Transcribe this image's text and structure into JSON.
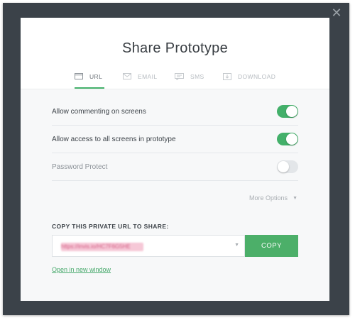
{
  "modal": {
    "title": "Share Prototype",
    "close_glyph": "✕"
  },
  "tabs": [
    {
      "label": "URL",
      "icon": "browser-window-icon",
      "active": true
    },
    {
      "label": "EMAIL",
      "icon": "envelope-icon",
      "active": false
    },
    {
      "label": "SMS",
      "icon": "chat-bubble-icon",
      "active": false
    },
    {
      "label": "DOWNLOAD",
      "icon": "download-icon",
      "active": false
    }
  ],
  "options": [
    {
      "label": "Allow commenting on screens",
      "enabled": true
    },
    {
      "label": "Allow access to all screens in prototype",
      "enabled": true
    },
    {
      "label": "Password Protect",
      "enabled": false
    }
  ],
  "more_options": {
    "label": "More Options",
    "caret": "▼"
  },
  "share": {
    "label": "COPY THIS PRIVATE URL TO SHARE:",
    "url_value": "https://invis.io/HC7F6G5HE",
    "url_caret": "▼",
    "copy_label": "COPY",
    "open_link": "Open in new window"
  },
  "colors": {
    "accent": "#45b16b",
    "backdrop": "#3b4249",
    "toggle_off": "#e3e6e9"
  }
}
